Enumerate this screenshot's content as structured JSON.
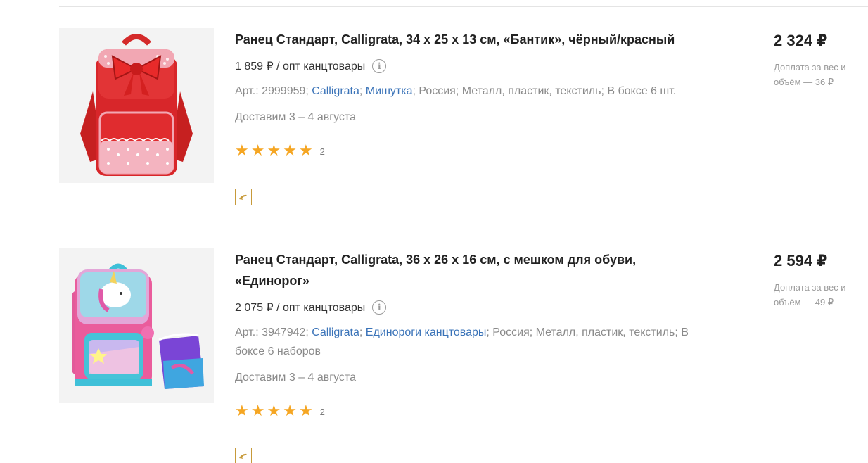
{
  "products": [
    {
      "title": "Ранец Стандарт, Calligrata, 34 х 25 х 13 см, «Бантик», чёрный/красный",
      "wholesale_price": "1 859 ₽ / опт канцтовары",
      "info_icon": "info-icon",
      "article": "Арт.: 2999959;",
      "brand_link": "Calligrata",
      "sep1": ";",
      "collection_link": "Мишутка",
      "meta_rest": "; Россия; Металл, пластик, текстиль; В боксе 6 шт.",
      "delivery": "Доставим 3 – 4 августа",
      "rating_count": "2",
      "price": "2 324 ₽",
      "surcharge": "Доплата за вес и объём — 36 ₽",
      "image_alt": "red backpack with bow"
    },
    {
      "title": "Ранец Стандарт, Calligrata, 36 х 26 х 16 см, с мешком для обуви, «Единорог»",
      "wholesale_price": "2 075 ₽ / опт канцтовары",
      "info_icon": "info-icon",
      "article": "Арт.: 3947942;",
      "brand_link": "Calligrata",
      "sep1": ";",
      "collection_link": "Единороги канцтовары",
      "meta_rest": "; Россия; Металл, пластик, текстиль; В боксе 6 наборов",
      "delivery": "Доставим 3 – 4 августа",
      "rating_count": "2",
      "price": "2 594 ₽",
      "surcharge": "Доплата за вес и объём — 49 ₽",
      "image_alt": "pink unicorn backpack with shoe bag"
    }
  ],
  "rating_stars": 5,
  "colors": {
    "star": "#f5a623",
    "link": "#3a73b8",
    "muted": "#8a8a8a"
  }
}
